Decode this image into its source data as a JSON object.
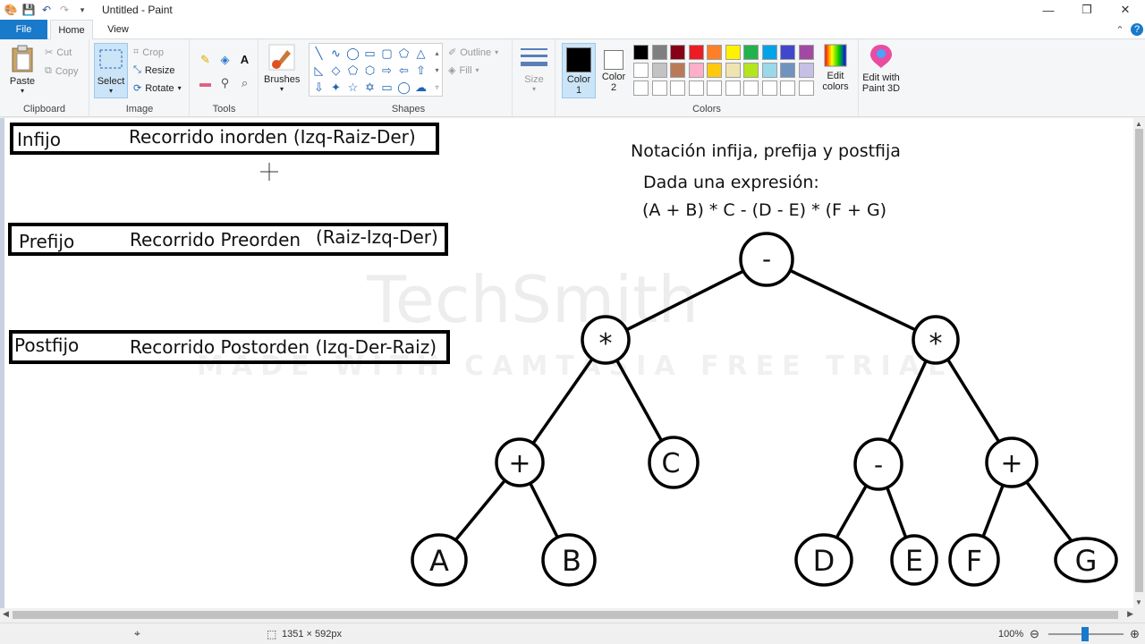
{
  "window": {
    "title": "Untitled - Paint"
  },
  "tabs": {
    "file": "File",
    "home": "Home",
    "view": "View"
  },
  "ribbon": {
    "clipboard": {
      "label": "Clipboard",
      "paste": "Paste",
      "cut": "Cut",
      "copy": "Copy"
    },
    "image": {
      "label": "Image",
      "select": "Select",
      "crop": "Crop",
      "resize": "Resize",
      "rotate": "Rotate"
    },
    "tools": {
      "label": "Tools"
    },
    "brushes": {
      "label": "Brushes"
    },
    "shapes": {
      "label": "Shapes",
      "outline": "Outline",
      "fill": "Fill"
    },
    "size": {
      "label": "Size"
    },
    "colors": {
      "label": "Colors",
      "color1_label": "Color",
      "color1_num": "1",
      "color2_label": "Color",
      "color2_num": "2",
      "edit_colors_line1": "Edit",
      "edit_colors_line2": "colors",
      "color1": "#000000",
      "color2": "#ffffff",
      "palette_row1": [
        "#000000",
        "#7f7f7f",
        "#880015",
        "#ed1c24",
        "#ff7f27",
        "#fff200",
        "#22b14c",
        "#00a2e8",
        "#3f48cc",
        "#a349a4"
      ],
      "palette_row2": [
        "#ffffff",
        "#c3c3c3",
        "#b97a57",
        "#ffaec9",
        "#ffc90e",
        "#efe4b0",
        "#b5e61d",
        "#99d9ea",
        "#7092be",
        "#c8bfe7"
      ]
    },
    "paint3d": {
      "line1": "Edit with",
      "line2": "Paint 3D"
    }
  },
  "canvas": {
    "boxes": [
      {
        "name": "Infijo",
        "desc": "Recorrido inorden (Izq-Raiz-Der)"
      },
      {
        "name": "Prefijo",
        "desc": "Recorrido Preorden",
        "desc2": "(Raiz-Izq-Der)"
      },
      {
        "name": "Postfijo",
        "desc": "Recorrido Postorden (Izq-Der-Raiz)"
      }
    ],
    "heading": "Notación infija, prefija y postfija",
    "given": "Dada una expresión:",
    "expression": "(A + B) * C - (D - E) * (F + G)",
    "watermark1": "TechSmith",
    "watermark2": "MADE WITH CAMTASIA FREE TRIAL",
    "tree": {
      "root": "-",
      "left": "*",
      "right": "*",
      "ll": "+",
      "lr": "C",
      "rl": "-",
      "rr": "+",
      "a": "A",
      "b": "B",
      "d": "D",
      "e": "E",
      "f": "F",
      "g": "G"
    }
  },
  "status": {
    "dimensions": "1351 × 592px",
    "zoom": "100%"
  }
}
